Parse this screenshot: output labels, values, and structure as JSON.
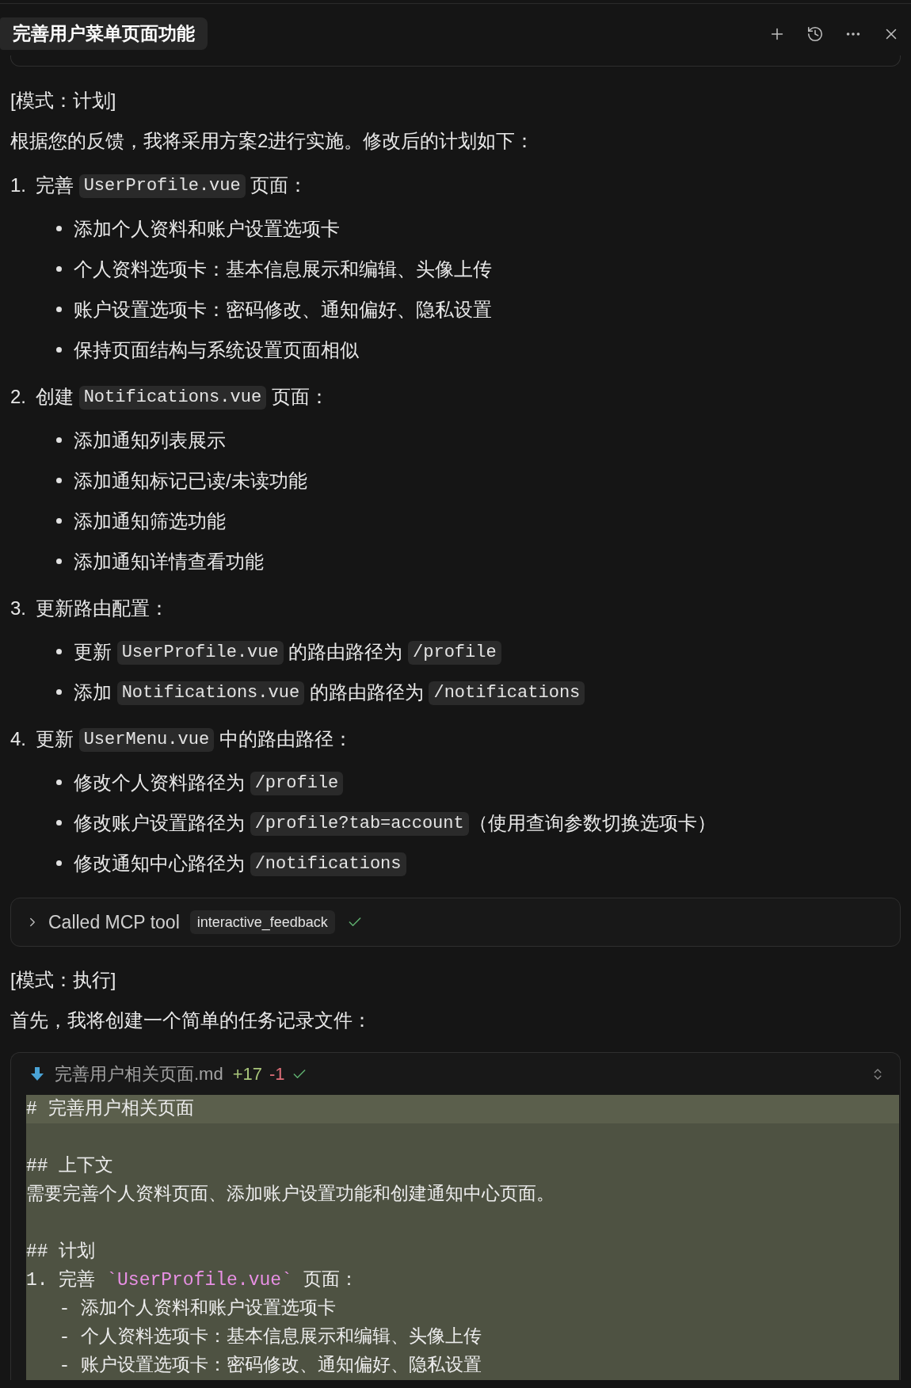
{
  "header": {
    "title": "完善用户菜单页面功能"
  },
  "blocks": [
    {
      "kind": "paragraph",
      "text": "[模式：计划]"
    },
    {
      "kind": "paragraph",
      "text": "根据您的反馈，我将采用方案2进行实施。修改后的计划如下："
    },
    {
      "kind": "ordered_list",
      "items": [
        {
          "number": "1.",
          "segments": [
            {
              "kind": "text",
              "text": "完善 "
            },
            {
              "kind": "code",
              "text": "UserProfile.vue"
            },
            {
              "kind": "text",
              "text": " 页面："
            }
          ],
          "bullets": [
            {
              "segments": [
                {
                  "kind": "text",
                  "text": "添加个人资料和账户设置选项卡"
                }
              ]
            },
            {
              "segments": [
                {
                  "kind": "text",
                  "text": "个人资料选项卡：基本信息展示和编辑、头像上传"
                }
              ]
            },
            {
              "segments": [
                {
                  "kind": "text",
                  "text": "账户设置选项卡：密码修改、通知偏好、隐私设置"
                }
              ]
            },
            {
              "segments": [
                {
                  "kind": "text",
                  "text": "保持页面结构与系统设置页面相似"
                }
              ]
            }
          ]
        },
        {
          "number": "2.",
          "segments": [
            {
              "kind": "text",
              "text": "创建 "
            },
            {
              "kind": "code",
              "text": "Notifications.vue"
            },
            {
              "kind": "text",
              "text": " 页面："
            }
          ],
          "bullets": [
            {
              "segments": [
                {
                  "kind": "text",
                  "text": "添加通知列表展示"
                }
              ]
            },
            {
              "segments": [
                {
                  "kind": "text",
                  "text": "添加通知标记已读/未读功能"
                }
              ]
            },
            {
              "segments": [
                {
                  "kind": "text",
                  "text": "添加通知筛选功能"
                }
              ]
            },
            {
              "segments": [
                {
                  "kind": "text",
                  "text": "添加通知详情查看功能"
                }
              ]
            }
          ]
        },
        {
          "number": "3.",
          "segments": [
            {
              "kind": "text",
              "text": "更新路由配置："
            }
          ],
          "bullets": [
            {
              "segments": [
                {
                  "kind": "text",
                  "text": "更新 "
                },
                {
                  "kind": "code",
                  "text": "UserProfile.vue"
                },
                {
                  "kind": "text",
                  "text": " 的路由路径为 "
                },
                {
                  "kind": "code",
                  "text": "/profile"
                }
              ]
            },
            {
              "segments": [
                {
                  "kind": "text",
                  "text": "添加 "
                },
                {
                  "kind": "code",
                  "text": "Notifications.vue"
                },
                {
                  "kind": "text",
                  "text": " 的路由路径为 "
                },
                {
                  "kind": "code",
                  "text": "/notifications"
                }
              ]
            }
          ]
        },
        {
          "number": "4.",
          "segments": [
            {
              "kind": "text",
              "text": "更新 "
            },
            {
              "kind": "code",
              "text": "UserMenu.vue"
            },
            {
              "kind": "text",
              "text": " 中的路由路径："
            }
          ],
          "bullets": [
            {
              "segments": [
                {
                  "kind": "text",
                  "text": "修改个人资料路径为 "
                },
                {
                  "kind": "code",
                  "text": "/profile"
                }
              ]
            },
            {
              "segments": [
                {
                  "kind": "text",
                  "text": "修改账户设置路径为 "
                },
                {
                  "kind": "code",
                  "text": "/profile?tab=account"
                },
                {
                  "kind": "text",
                  "text": "（使用查询参数切换选项卡）"
                }
              ]
            },
            {
              "segments": [
                {
                  "kind": "text",
                  "text": "修改通知中心路径为 "
                },
                {
                  "kind": "code",
                  "text": "/notifications"
                }
              ]
            }
          ]
        }
      ]
    },
    {
      "kind": "tool_call",
      "label": "Called MCP tool",
      "tool": "interactive_feedback",
      "expanded": false,
      "done": true
    },
    {
      "kind": "paragraph",
      "text": "[模式：执行]"
    },
    {
      "kind": "paragraph",
      "text": "首先，我将创建一个简单的任务记录文件："
    },
    {
      "kind": "file_edit",
      "name": "完善用户相关页面.md",
      "added": "+17",
      "removed": "-1",
      "applied": true,
      "lines": [
        {
          "kind": "text",
          "highlighted": true,
          "tokens": [
            {
              "kind": "plain",
              "text": "# 完善用户相关页面"
            }
          ]
        },
        {
          "kind": "blank"
        },
        {
          "kind": "text",
          "highlighted": false,
          "tokens": [
            {
              "kind": "plain",
              "text": "## 上下文"
            }
          ]
        },
        {
          "kind": "text",
          "highlighted": false,
          "tokens": [
            {
              "kind": "plain",
              "text": "需要完善个人资料页面、添加账户设置功能和创建通知中心页面。"
            }
          ]
        },
        {
          "kind": "blank"
        },
        {
          "kind": "text",
          "highlighted": false,
          "tokens": [
            {
              "kind": "plain",
              "text": "## 计划"
            }
          ]
        },
        {
          "kind": "text",
          "highlighted": false,
          "tokens": [
            {
              "kind": "plain",
              "text": "1. 完善 "
            },
            {
              "kind": "code",
              "text": "`UserProfile.vue`"
            },
            {
              "kind": "plain",
              "text": " 页面："
            }
          ]
        },
        {
          "kind": "text",
          "highlighted": false,
          "tokens": [
            {
              "kind": "plain",
              "text": "   - 添加个人资料和账户设置选项卡"
            }
          ]
        },
        {
          "kind": "text",
          "highlighted": false,
          "tokens": [
            {
              "kind": "plain",
              "text": "   - 个人资料选项卡：基本信息展示和编辑、头像上传"
            }
          ]
        },
        {
          "kind": "text",
          "highlighted": false,
          "tokens": [
            {
              "kind": "plain",
              "text": "   - 账户设置选项卡：密码修改、通知偏好、隐私设置"
            }
          ]
        }
      ]
    }
  ]
}
